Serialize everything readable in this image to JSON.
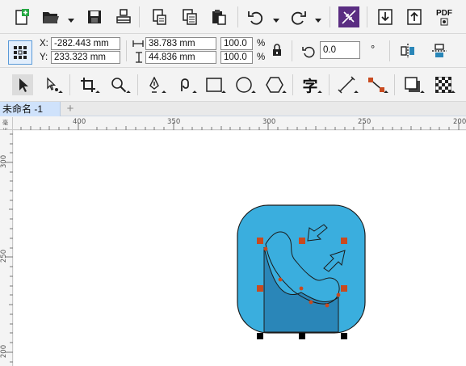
{
  "toolbar_standard": {
    "icons": [
      "new-document-icon",
      "open-folder-icon",
      "save-icon",
      "print-icon",
      "import-icon",
      "copy-icon",
      "paste-icon",
      "undo-icon",
      "redo-icon",
      "connect-icon",
      "import-arrow-icon",
      "export-arrow-icon",
      "pdf-export-icon"
    ],
    "pdf_label": "PDF"
  },
  "property_bar": {
    "x_label": "X:",
    "x_value": "-282.443 mm",
    "y_label": "Y:",
    "y_value": "233.323 mm",
    "width_value": "38.783 mm",
    "height_value": "44.836 mm",
    "scale_x": "100.0",
    "scale_y": "100.0",
    "percent": "%",
    "rotation_value": "0.0",
    "degree_symbol": "°"
  },
  "toolbox": {
    "tools": [
      "pick-tool",
      "shape-tool",
      "crop-tool",
      "zoom-tool",
      "pen-tool",
      "artistic-media-tool",
      "rectangle-tool",
      "ellipse-tool",
      "polygon-tool",
      "text-tool",
      "dimension-tool",
      "connector-tool",
      "drop-shadow-tool",
      "transparency-tool"
    ],
    "text_tool_glyph": "字"
  },
  "document_tabs": {
    "active_tab": "未命名 -1",
    "add_tab": "+"
  },
  "rulers": {
    "horizontal": [
      "400",
      "350",
      "300",
      "250",
      "200"
    ],
    "vertical": [
      "300",
      "250",
      "200"
    ],
    "unit_marker": "毫米"
  },
  "colors": {
    "icon_fill": "#3aaede",
    "icon_dark_fill": "#2a86b8",
    "node_color": "#c84a1f",
    "accent_purple": "#5a2d82",
    "tab_active": "#cfe2fb"
  }
}
